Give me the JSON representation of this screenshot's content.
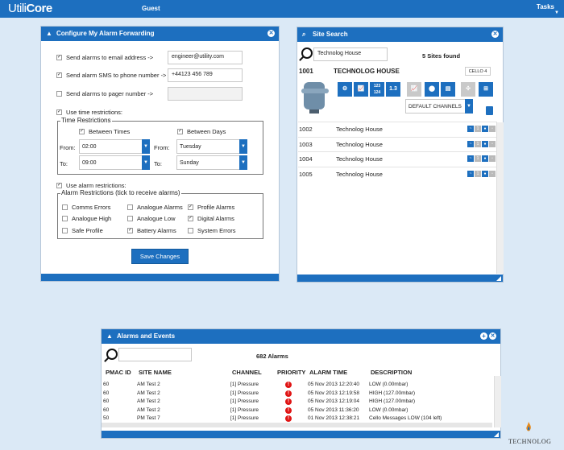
{
  "header": {
    "logo": "UtiliCore",
    "logo_a": "Utili",
    "logo_b": "Core",
    "user": "Guest",
    "tasks": "Tasks"
  },
  "forwarding": {
    "title": "Configure My Alarm Forwarding",
    "email_label": "Send alarms to email address ->",
    "email_value": "engineer@utility.com",
    "sms_label": "Send alarm SMS to phone number ->",
    "sms_value": "+44123 456 789",
    "pager_label": "Send alarms to pager number ->",
    "pager_value": "",
    "time_restrictions_check": "Use time restrictions:",
    "time_group": "Time Restrictions",
    "between_times": "Between Times",
    "between_days": "Between Days",
    "from": "From:",
    "to": "To:",
    "time_from": "02:00",
    "time_to": "09:00",
    "day_from": "Tuesday",
    "day_to": "Sunday",
    "alarm_restrictions_check": "Use alarm restrictions:",
    "alarm_group": "Alarm Restrictions (tick to receive alarms)",
    "alarm_types": [
      {
        "label": "Comms Errors",
        "checked": false
      },
      {
        "label": "Analogue Alarms",
        "checked": false
      },
      {
        "label": "Profile Alarms",
        "checked": true
      },
      {
        "label": "Analogue High",
        "checked": false
      },
      {
        "label": "Analogue Low",
        "checked": false
      },
      {
        "label": "Digital Alarms",
        "checked": true
      },
      {
        "label": "Safe Profile",
        "checked": false
      },
      {
        "label": "Battery Alarms",
        "checked": true
      },
      {
        "label": "System Errors",
        "checked": false
      }
    ],
    "save": "Save Changes"
  },
  "site_search": {
    "title": "Site Search",
    "query": "Technolog House",
    "result_count": "5 Sites found",
    "selected": {
      "id": "1001",
      "name": "TECHNOLOG HOUSE",
      "device": "CELLO 4"
    },
    "tile_labels": {
      "t123": "123\n124",
      "t13": "1.3"
    },
    "channels": "DEFAULT CHANNELS",
    "sites": [
      {
        "id": "1002",
        "name": "Technolog House"
      },
      {
        "id": "1003",
        "name": "Technolog House"
      },
      {
        "id": "1004",
        "name": "Technolog House"
      },
      {
        "id": "1005",
        "name": "Technolog House"
      }
    ]
  },
  "alarms": {
    "title": "Alarms and Events",
    "count": "682 Alarms",
    "columns": [
      "PMAC ID",
      "SITE NAME",
      "CHANNEL",
      "PRIORITY",
      "ALARM TIME",
      "DESCRIPTION"
    ],
    "rows": [
      {
        "id": "60",
        "site": "AM Test 2",
        "channel": "[1] Pressure",
        "time": "05 Nov 2013 12:20:40",
        "desc": "LOW (0.00mbar)"
      },
      {
        "id": "60",
        "site": "AM Test 2",
        "channel": "[1] Pressure",
        "time": "05 Nov 2013 12:19:58",
        "desc": "HIGH (127.00mbar)"
      },
      {
        "id": "60",
        "site": "AM Test 2",
        "channel": "[1] Pressure",
        "time": "05 Nov 2013 12:19:04",
        "desc": "HIGH (127.00mbar)"
      },
      {
        "id": "60",
        "site": "AM Test 2",
        "channel": "[1] Pressure",
        "time": "05 Nov 2013 11:36:20",
        "desc": "LOW (0.00mbar)"
      },
      {
        "id": "50",
        "site": "PM Test 7",
        "channel": "[1] Pressure",
        "time": "01 Nov 2013 12:38:21",
        "desc": "Cello Messages LOW (104 left)"
      }
    ]
  },
  "brand": "TECHNOLOG",
  "colors": {
    "primary": "#1d6fbf",
    "background": "#dbe9f6",
    "alert": "#e01414"
  }
}
